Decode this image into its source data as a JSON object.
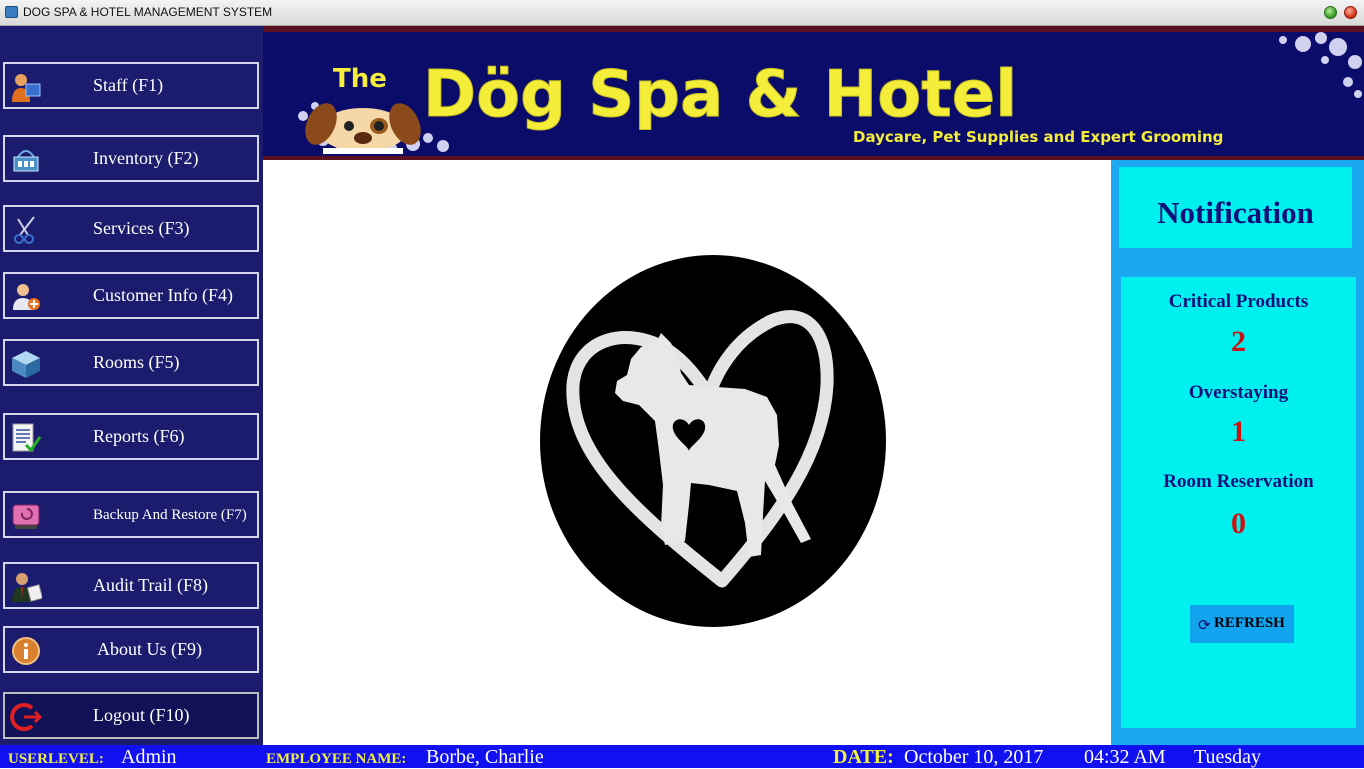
{
  "window": {
    "title": "DOG SPA & HOTEL MANAGEMENT SYSTEM"
  },
  "sidebar": {
    "items": [
      {
        "label": "Staff (F1)",
        "icon": "staff-icon"
      },
      {
        "label": "Inventory (F2)",
        "icon": "basket-icon"
      },
      {
        "label": "Services (F3)",
        "icon": "scissors-icon"
      },
      {
        "label": "Customer Info (F4)",
        "icon": "add-customer-icon"
      },
      {
        "label": "Rooms (F5)",
        "icon": "cube-icon"
      },
      {
        "label": "Reports (F6)",
        "icon": "report-check-icon"
      },
      {
        "label": "Backup And Restore (F7)",
        "icon": "disk-icon"
      },
      {
        "label": "Audit Trail (F8)",
        "icon": "auditor-icon"
      },
      {
        "label": "About Us (F9)",
        "icon": "info-icon"
      },
      {
        "label": "Logout (F10)",
        "icon": "logout-icon"
      }
    ]
  },
  "banner": {
    "the": "The",
    "title": "Dög Spa & Hotel",
    "subtitle": "Daycare, Pet Supplies and Expert Grooming"
  },
  "notification": {
    "title": "Notification",
    "critical_label": "Critical Products",
    "critical_value": "2",
    "overstaying_label": "Overstaying",
    "overstaying_value": "1",
    "reservation_label": "Room Reservation",
    "reservation_value": "0",
    "refresh_label": "REFRESH"
  },
  "status": {
    "userlevel_label": "USERLEVEL:",
    "userlevel": "Admin",
    "employee_label": "EMPLOYEE NAME:",
    "employee": "Borbe, Charlie",
    "date_label": "DATE:",
    "date": "October 10, 2017",
    "time": "04:32 AM",
    "day": "Tuesday"
  },
  "colors": {
    "sidebar_bg": "#1c1c6e",
    "banner_bg": "#0b0b6a",
    "banner_text": "#f4ee3a",
    "panel_bg": "#1aa8f0",
    "panel_inner": "#00f0f0",
    "stat_value": "#d01010",
    "statusbar_bg": "#1010f0"
  }
}
